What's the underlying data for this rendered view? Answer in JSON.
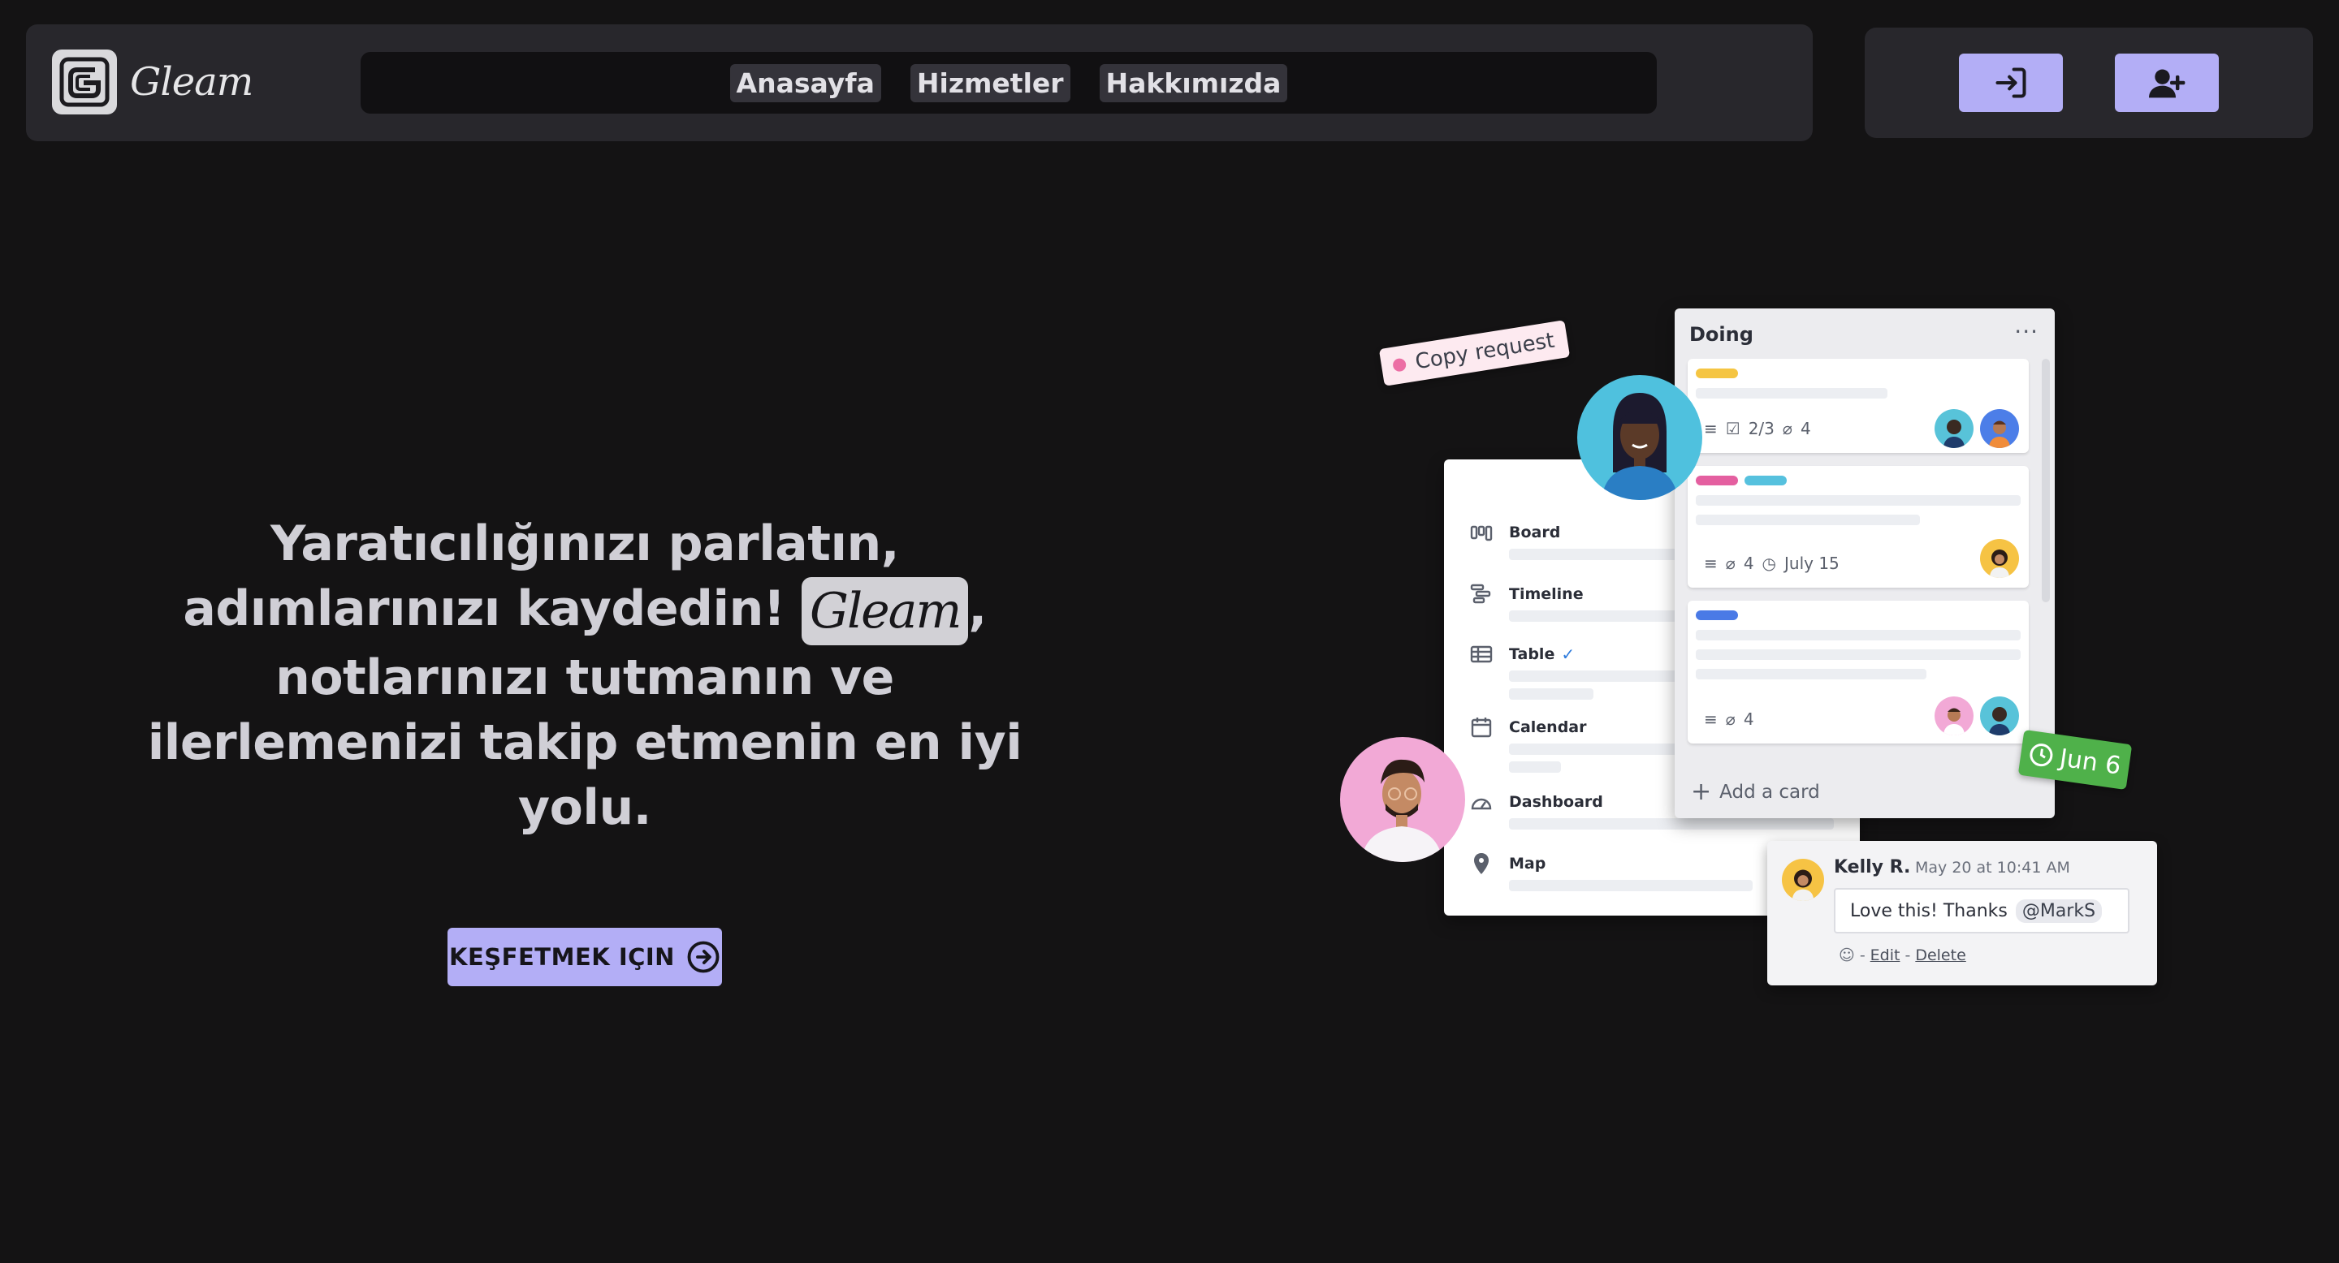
{
  "brand": {
    "name": "Gleam"
  },
  "nav": {
    "links": [
      "Anasayfa",
      "Hizmetler",
      "Hakkımızda"
    ],
    "login_icon": "login-icon",
    "signup_icon": "user-plus-icon"
  },
  "hero": {
    "title_part1": "Yaratıcılığınızı parlatın, adımlarınızı kaydedin! ",
    "title_brand": "Gleam",
    "title_part2": ", notlarınızı tutmanın ve ilerlemenizi takip etmenin en iyi yolu.",
    "cta_label": "KEŞFETMEK IÇIN",
    "cta_icon": "arrow-right-circle-icon"
  },
  "illustration": {
    "copy_request": "Copy request",
    "sidebar_items": [
      "Board",
      "Timeline",
      "Table",
      "Calendar",
      "Dashboard",
      "Map"
    ],
    "list_title": "Doing",
    "cards": [
      {
        "checklist": "2/3",
        "attachments": "4"
      },
      {
        "attachments": "4",
        "due": "July 15"
      },
      {
        "attachments": "4"
      }
    ],
    "add_card": "Add a card",
    "due_tag": "Jun 6",
    "comment": {
      "author": "Kelly R.",
      "time": "May 20 at 10:41 AM",
      "text": "Love this! Thanks",
      "mention": "@MarkS",
      "edit": "Edit",
      "delete": "Delete"
    }
  },
  "colors": {
    "background": "#141314",
    "panel": "#28272c",
    "accent": "#b3aef6",
    "green": "#4fb14a"
  }
}
